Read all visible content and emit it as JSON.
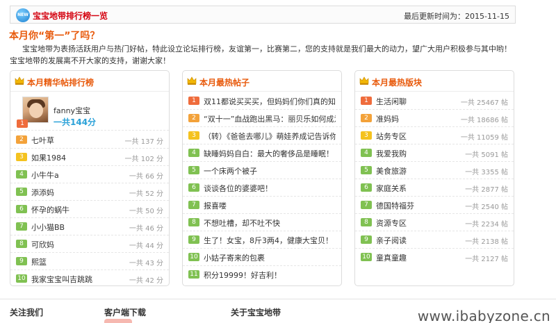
{
  "header": {
    "title": "宝宝地带排行榜一览",
    "updated": "最后更新时间为：2015-11-15",
    "new_badge": "NEW"
  },
  "question_title": "本月你“第一”了吗？",
  "intro": "宝宝地带为表扬活跃用户与热门好帖，特此设立论坛排行榜，友谊第一，比赛第二，您的支持就是我们最大的动力，望广大用户积极参与其中哟！宝宝地带的发展离不开大家的支持，谢谢大家！",
  "panels": {
    "elite": {
      "title": "本月精华帖排行榜",
      "top": {
        "rank": "1",
        "name": "fanny宝宝",
        "total": "一共144分"
      },
      "items": [
        {
          "rank": "2",
          "label": "七叶草",
          "value": "一共 137 分"
        },
        {
          "rank": "3",
          "label": "如果1984",
          "value": "一共 102 分"
        },
        {
          "rank": "4",
          "label": "小牛牛a",
          "value": "一共 66 分"
        },
        {
          "rank": "5",
          "label": "添添妈",
          "value": "一共 52 分"
        },
        {
          "rank": "6",
          "label": "怀孕的蜗牛",
          "value": "一共 50 分"
        },
        {
          "rank": "7",
          "label": "小小猫BB",
          "value": "一共 46 分"
        },
        {
          "rank": "8",
          "label": "可欣妈",
          "value": "一共 44 分"
        },
        {
          "rank": "9",
          "label": "熙篮",
          "value": "一共 43 分"
        },
        {
          "rank": "10",
          "label": "我家宝宝叫吉跳跳",
          "value": "一共 42 分"
        }
      ]
    },
    "hot_posts": {
      "title": "本月最热帖子",
      "items": [
        {
          "rank": "1",
          "label": "双11都说买买买，但妈妈们你们真的知道买"
        },
        {
          "rank": "2",
          "label": "“双十一”血战跑出黑马：丽贝乐如何成为妈"
        },
        {
          "rank": "3",
          "label": "（转）《爸爸去哪儿》萌娃养成记告诉你儿童"
        },
        {
          "rank": "4",
          "label": "缺睡妈妈自白：最大的奢侈品是睡眠！"
        },
        {
          "rank": "5",
          "label": "一个床两个被子"
        },
        {
          "rank": "6",
          "label": "谈谈各位的婆婆吧！"
        },
        {
          "rank": "7",
          "label": "报喜喽"
        },
        {
          "rank": "8",
          "label": "不想吐槽，却不吐不快"
        },
        {
          "rank": "9",
          "label": "生了！女宝，8斤3两4，健康大宝贝！"
        },
        {
          "rank": "10",
          "label": "小姑子寄来的包裹"
        },
        {
          "rank": "11",
          "label": "积分19999！好吉利！"
        }
      ]
    },
    "hot_boards": {
      "title": "本月最热版块",
      "items": [
        {
          "rank": "1",
          "label": "生活闲聊",
          "value": "一共 25467 帖"
        },
        {
          "rank": "2",
          "label": "准妈妈",
          "value": "一共 18686 帖"
        },
        {
          "rank": "3",
          "label": "站务专区",
          "value": "一共 11059 帖"
        },
        {
          "rank": "4",
          "label": "我爱我购",
          "value": "一共 5091 帖"
        },
        {
          "rank": "5",
          "label": "美食旅游",
          "value": "一共 3355 帖"
        },
        {
          "rank": "6",
          "label": "家庭关系",
          "value": "一共 2877 帖"
        },
        {
          "rank": "7",
          "label": "德国特福芬",
          "value": "一共 2540 帖"
        },
        {
          "rank": "8",
          "label": "资源专区",
          "value": "一共 2234 帖"
        },
        {
          "rank": "9",
          "label": "亲子阅读",
          "value": "一共 2138 帖"
        },
        {
          "rank": "10",
          "label": "童真童趣",
          "value": "一共 2127 帖"
        }
      ]
    }
  },
  "footer": {
    "follow": "关注我们",
    "client": "客户端下载",
    "about": "关于宝宝地带",
    "watermark": "www.ibabyzone.cn"
  },
  "colors": {
    "title_red": "#d4000e",
    "accent_orange": "#e85a0c",
    "total_blue": "#2aa1d8",
    "rank1": "#ef6c3c",
    "rank2": "#f3a23a",
    "rank3": "#f4c21f",
    "rank_other": "#80c152"
  }
}
